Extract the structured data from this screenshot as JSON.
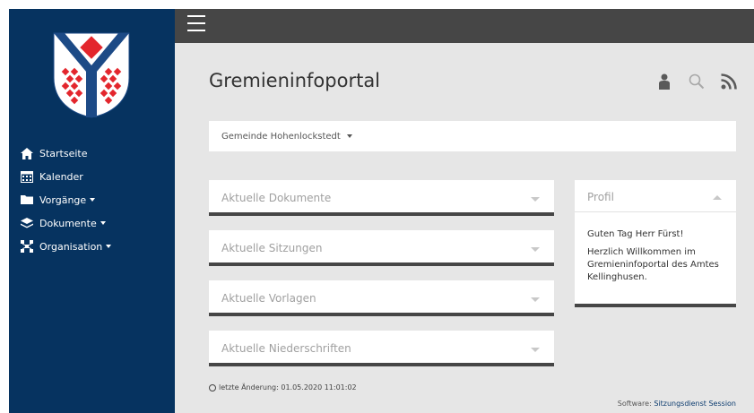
{
  "sidebar": {
    "logo_icon": "coat-of-arms",
    "items": [
      {
        "label": "Startseite",
        "icon": "home-icon",
        "has_caret": false
      },
      {
        "label": "Kalender",
        "icon": "calendar-icon",
        "has_caret": false
      },
      {
        "label": "Vorgänge",
        "icon": "folder-icon",
        "has_caret": true
      },
      {
        "label": "Dokumente",
        "icon": "layers-icon",
        "has_caret": true
      },
      {
        "label": "Organisation",
        "icon": "sitemap-icon",
        "has_caret": true
      }
    ]
  },
  "header": {
    "menu_icon": "hamburger-icon",
    "title": "Gremieninfoportal",
    "icons": [
      "user-icon",
      "search-icon",
      "rss-icon"
    ]
  },
  "gemeinde": {
    "label": "Gemeinde Hohenlockstedt"
  },
  "panels": [
    {
      "title": "Aktuelle Dokumente"
    },
    {
      "title": "Aktuelle Sitzungen"
    },
    {
      "title": "Aktuelle Vorlagen"
    },
    {
      "title": "Aktuelle Niederschriften"
    }
  ],
  "profil": {
    "title": "Profil",
    "greeting": "Guten Tag Herr Fürst!",
    "welcome": "Herzlich Willkommen im Gremieninfoportal des Amtes Kellinghusen."
  },
  "footer": {
    "last_change": "letzte Änderung: 01.05.2020 11:01:02",
    "software_label": "Software:",
    "software_link": "Sitzungsdienst Session"
  },
  "colors": {
    "sidebar": "#063360",
    "topbar": "#464646",
    "main_bg": "#e6e6e6",
    "logo_red": "#e3262d"
  }
}
